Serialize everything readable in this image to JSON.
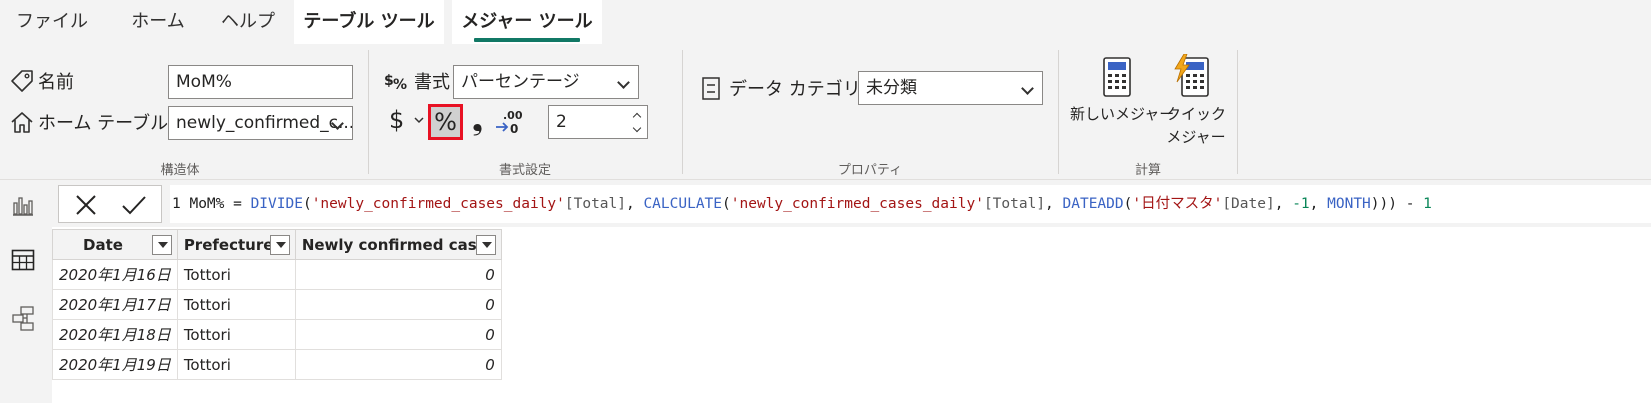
{
  "tabs": [
    {
      "label": "ファイル"
    },
    {
      "label": "ホーム"
    },
    {
      "label": "ヘルプ"
    },
    {
      "label": "テーブル ツール"
    },
    {
      "label": "メジャー ツール"
    }
  ],
  "structure": {
    "name_label": "名前",
    "name_value": "MoM%",
    "home_table_label": "ホーム テーブル",
    "home_table_value": "newly_confirmed_c...",
    "group_label": "構造体"
  },
  "formatting": {
    "format_label": "書式",
    "format_value": "パーセンテージ",
    "currency_symbol": "$",
    "percent_symbol": "%",
    "comma_symbol": "❟",
    "decimals_value": "2",
    "group_label": "書式設定"
  },
  "properties": {
    "data_category_label": "データ カテゴリ",
    "data_category_value": "未分類",
    "group_label": "プロパティ"
  },
  "calculations": {
    "new_measure_label": "新しいメジャー",
    "quick_measure_label_1": "クイック",
    "quick_measure_label_2": "メジャー",
    "group_label": "計算"
  },
  "formula": {
    "line_no": "1",
    "p1": " MoM% = ",
    "f1": "DIVIDE",
    "p2": "(",
    "s1": "'newly_confirmed_cases_daily'",
    "c1": "[Total]",
    "p3": ", ",
    "f2": "CALCULATE",
    "p4": "(",
    "s2": "'newly_confirmed_cases_daily'",
    "c2": "[Total]",
    "p5": ", ",
    "f3": "DATEADD",
    "p6": "(",
    "s3": "'日付マスタ'",
    "c3": "[Date]",
    "p7": ", ",
    "n1": "-1",
    "p8": ", ",
    "k1": "MONTH",
    "p9": "))) - ",
    "n2": "1"
  },
  "table": {
    "headers": [
      "Date",
      "Prefecture",
      "Newly confirmed cases"
    ],
    "rows": [
      [
        "2020年1月16日",
        "Tottori",
        "0"
      ],
      [
        "2020年1月17日",
        "Tottori",
        "0"
      ],
      [
        "2020年1月18日",
        "Tottori",
        "0"
      ],
      [
        "2020年1月19日",
        "Tottori",
        "0"
      ]
    ]
  },
  "colors": {
    "accent_underline": "#117865",
    "highlight_border": "#e81123"
  }
}
